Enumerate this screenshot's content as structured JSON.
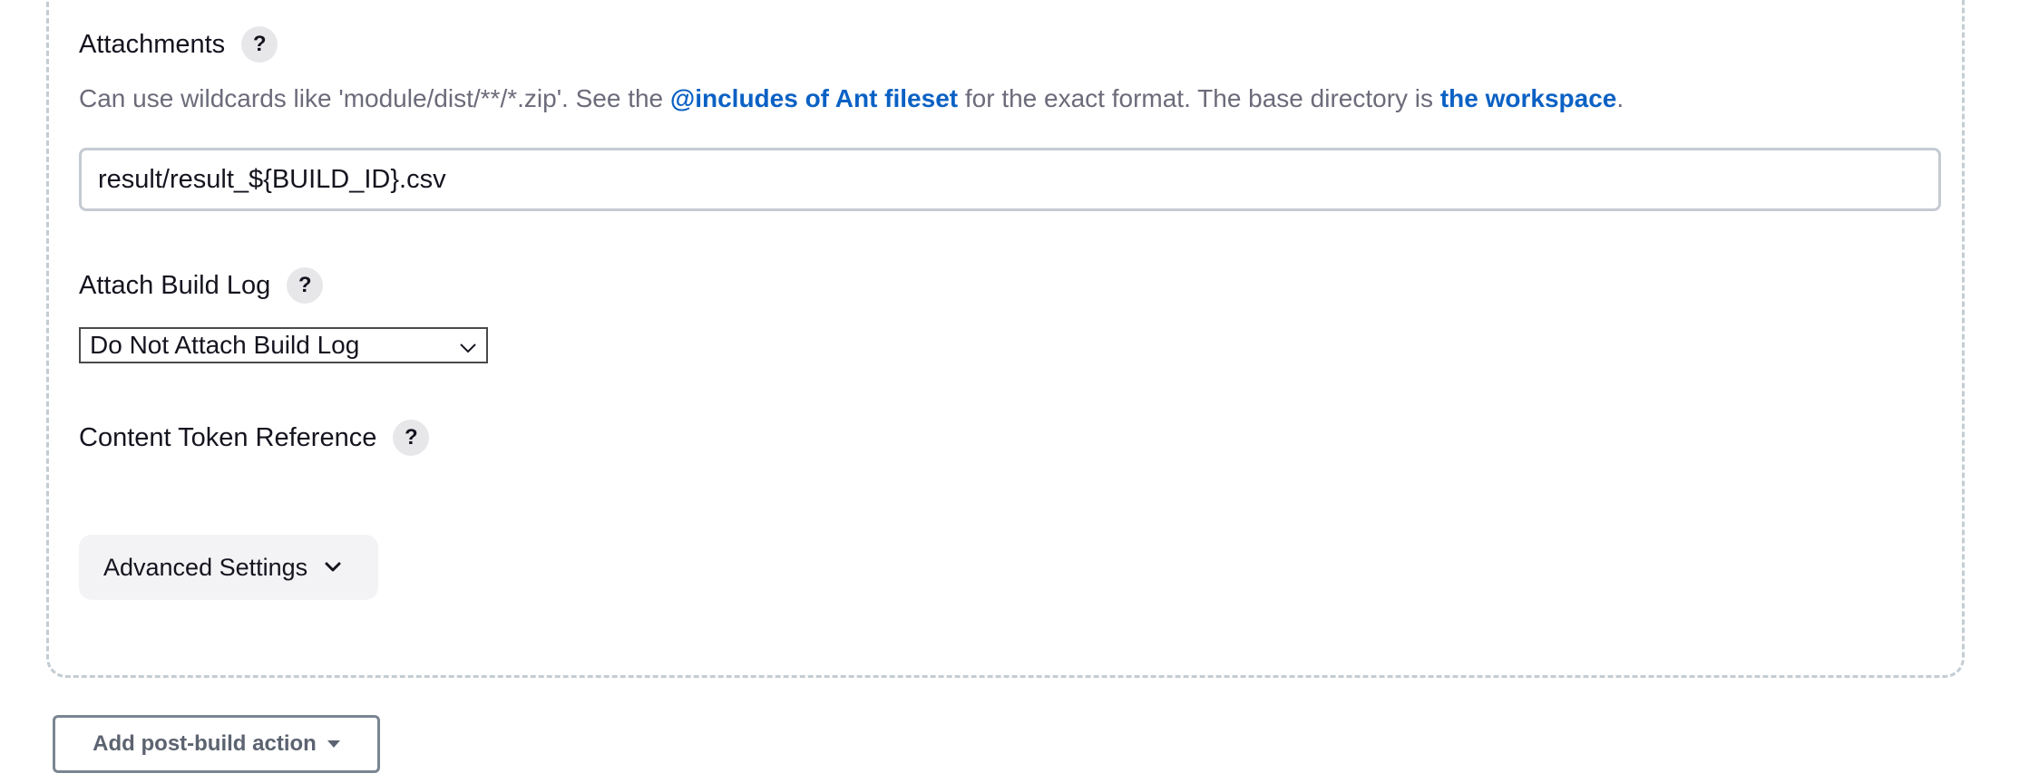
{
  "attachments": {
    "label": "Attachments",
    "help": "?",
    "desc_prefix": "Can use wildcards like 'module/dist/**/*.zip'. See the ",
    "desc_link1": "@includes of Ant fileset",
    "desc_middle": " for the exact format. The base directory is ",
    "desc_link2": "the workspace",
    "desc_suffix": ".",
    "value": "result/result_${BUILD_ID}.csv"
  },
  "attach_build_log": {
    "label": "Attach Build Log",
    "help": "?",
    "selected": "Do Not Attach Build Log"
  },
  "content_token": {
    "label": "Content Token Reference",
    "help": "?"
  },
  "advanced": {
    "label": "Advanced Settings",
    "icon": "chevron-down-icon"
  },
  "footer": {
    "add_action_label": "Add post-build action",
    "icon": "caret-down-icon"
  }
}
